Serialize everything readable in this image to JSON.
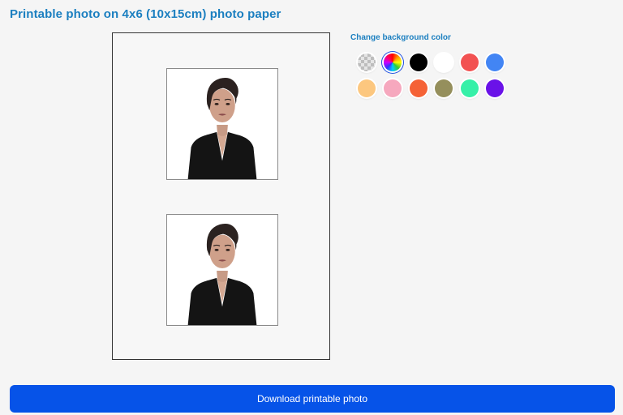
{
  "header": {
    "title": "Printable photo on 4x6 (10x15cm) photo paper"
  },
  "background_picker": {
    "label": "Change background color",
    "selected": "rainbow",
    "colors": [
      {
        "name": "transparent",
        "value": "transparent"
      },
      {
        "name": "rainbow",
        "value": "multicolor"
      },
      {
        "name": "black",
        "value": "#000000"
      },
      {
        "name": "white",
        "value": "#ffffff"
      },
      {
        "name": "red",
        "value": "#f25252"
      },
      {
        "name": "blue",
        "value": "#4285f4"
      },
      {
        "name": "peach",
        "value": "#fcc77f"
      },
      {
        "name": "pink",
        "value": "#f6a8be"
      },
      {
        "name": "orange",
        "value": "#f56236"
      },
      {
        "name": "olive",
        "value": "#958f5c"
      },
      {
        "name": "mint",
        "value": "#36f0a8"
      },
      {
        "name": "purple",
        "value": "#6a12e8"
      }
    ]
  },
  "preview": {
    "photo_background": "#ffffff",
    "photo_count": 2
  },
  "actions": {
    "download_label": "Download printable photo",
    "download_color": "#0653e8"
  }
}
